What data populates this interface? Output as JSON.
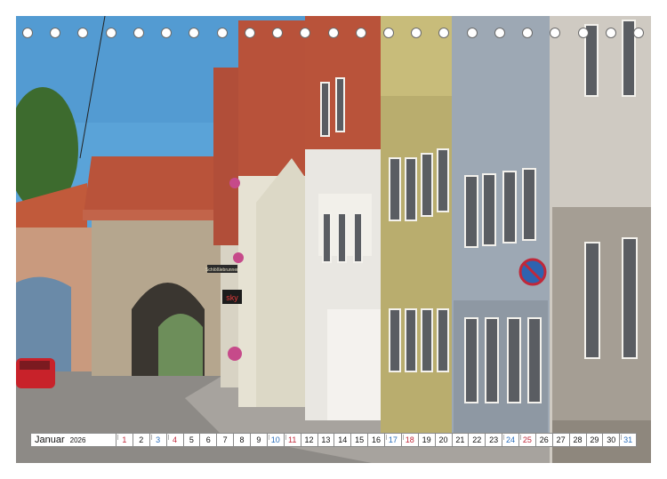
{
  "calendar": {
    "month": "Januar",
    "year": "2026",
    "days": [
      {
        "n": "1",
        "kind": "sun"
      },
      {
        "n": "2",
        "kind": "wd"
      },
      {
        "n": "3",
        "kind": "sat"
      },
      {
        "n": "4",
        "kind": "sun"
      },
      {
        "n": "5",
        "kind": "wd"
      },
      {
        "n": "6",
        "kind": "wd"
      },
      {
        "n": "7",
        "kind": "wd"
      },
      {
        "n": "8",
        "kind": "wd"
      },
      {
        "n": "9",
        "kind": "wd"
      },
      {
        "n": "10",
        "kind": "sat"
      },
      {
        "n": "11",
        "kind": "sun"
      },
      {
        "n": "12",
        "kind": "wd"
      },
      {
        "n": "13",
        "kind": "wd"
      },
      {
        "n": "14",
        "kind": "wd"
      },
      {
        "n": "15",
        "kind": "wd"
      },
      {
        "n": "16",
        "kind": "wd"
      },
      {
        "n": "17",
        "kind": "sat"
      },
      {
        "n": "18",
        "kind": "sun"
      },
      {
        "n": "19",
        "kind": "wd"
      },
      {
        "n": "20",
        "kind": "wd"
      },
      {
        "n": "21",
        "kind": "wd"
      },
      {
        "n": "22",
        "kind": "wd"
      },
      {
        "n": "23",
        "kind": "wd"
      },
      {
        "n": "24",
        "kind": "sat"
      },
      {
        "n": "25",
        "kind": "sun"
      },
      {
        "n": "26",
        "kind": "wd"
      },
      {
        "n": "27",
        "kind": "wd"
      },
      {
        "n": "28",
        "kind": "wd"
      },
      {
        "n": "29",
        "kind": "wd"
      },
      {
        "n": "30",
        "kind": "wd"
      },
      {
        "n": "31",
        "kind": "sat"
      }
    ]
  },
  "binding_holes": 23,
  "photo": {
    "signs": {
      "shop_sign": "sky",
      "street_sign": "Schlößlebrunnen"
    }
  },
  "colors": {
    "sky": "#4f9bd4",
    "roof": "#b8523a",
    "saturday": "#2a6ebb",
    "sunday": "#c0283a"
  }
}
